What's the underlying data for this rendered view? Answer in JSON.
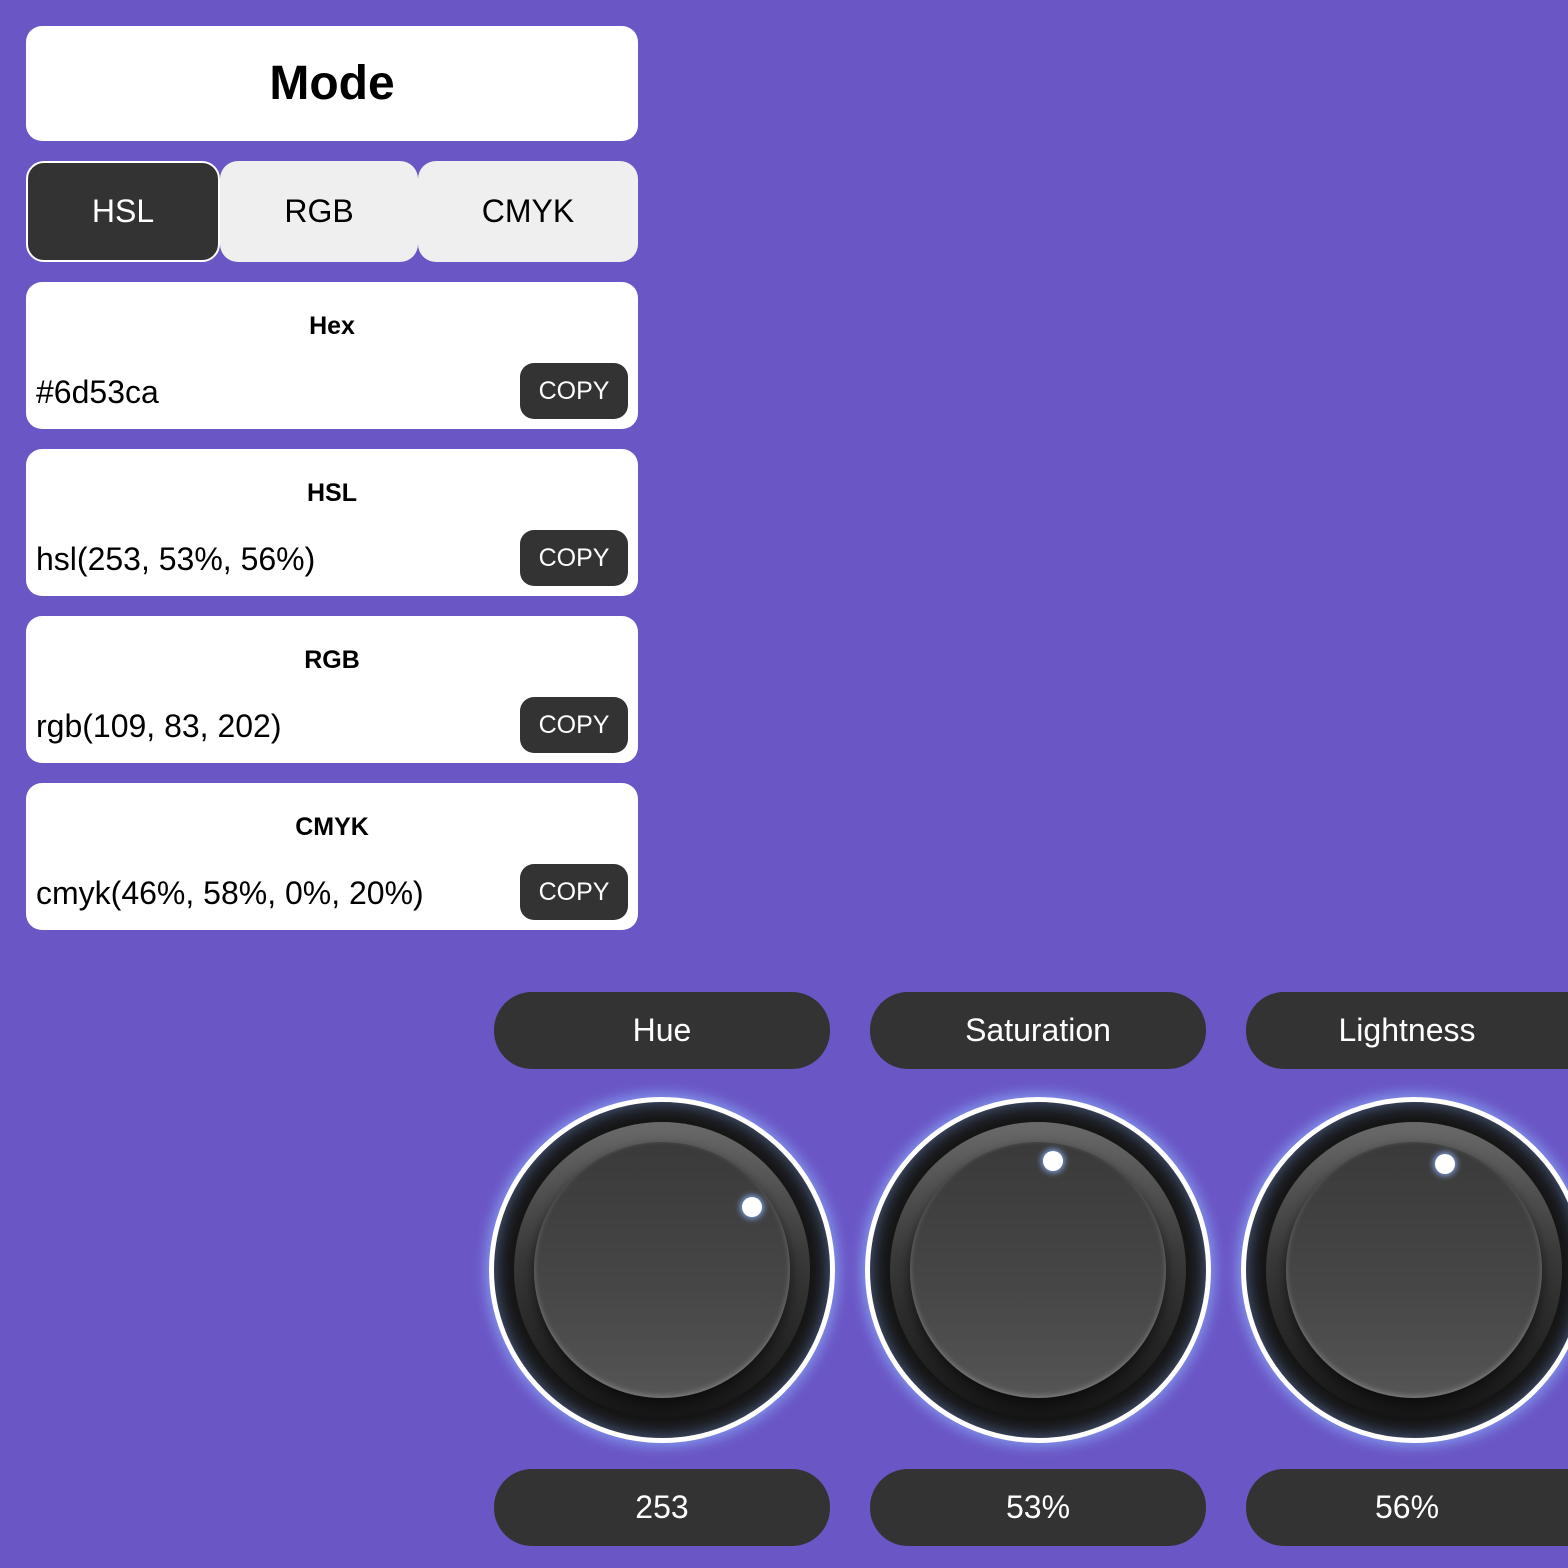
{
  "mode": {
    "title": "Mode"
  },
  "tabs": [
    {
      "label": "HSL",
      "active": true
    },
    {
      "label": "RGB",
      "active": false
    },
    {
      "label": "CMYK",
      "active": false
    }
  ],
  "cards": {
    "hex": {
      "label": "Hex",
      "value": "#6d53ca",
      "copy_label": "COPY"
    },
    "hsl": {
      "label": "HSL",
      "value": "hsl(253, 53%, 56%)",
      "copy_label": "COPY"
    },
    "rgb": {
      "label": "RGB",
      "value": "rgb(109, 83, 202)",
      "copy_label": "COPY"
    },
    "cmyk": {
      "label": "CMYK",
      "value": "cmyk(46%, 58%, 0%, 20%)",
      "copy_label": "COPY"
    }
  },
  "knobs": [
    {
      "label": "Hue",
      "value_text": "253",
      "level": 0.703
    },
    {
      "label": "Saturation",
      "value_text": "53%",
      "level": 0.53
    },
    {
      "label": "Lightness",
      "value_text": "56%",
      "level": 0.56
    }
  ],
  "colors": {
    "background": "#6a56c5",
    "dark": "#333333",
    "tab_inactive": "#efefef",
    "card": "#ffffff",
    "glow": "#8cb4ff"
  }
}
